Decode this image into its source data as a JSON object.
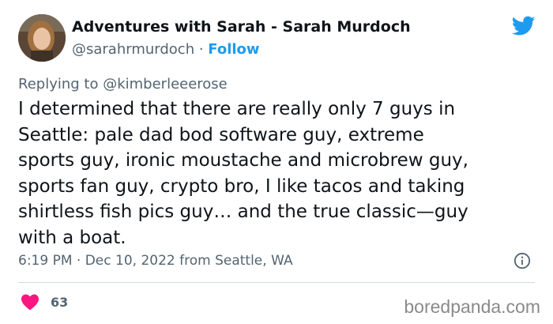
{
  "author": {
    "display_name": "Adventures with Sarah - Sarah Murdoch",
    "handle": "@sarahrmurdoch",
    "separator": " · ",
    "follow_label": "Follow"
  },
  "reply": {
    "prefix": "Replying to ",
    "mention": "@kimberleeerose"
  },
  "tweet": {
    "text": "I determined that there are really only 7 guys in\nSeattle: pale dad bod software guy, extreme\nsports guy, ironic moustache and microbrew guy,\nsports fan guy, crypto bro, I like tacos and taking\nshirtless fish pics guy… and the true classic—guy\nwith a boat.",
    "timestamp": "6:19 PM · Dec 10, 2022 from Seattle, WA"
  },
  "engagement": {
    "like_count": "63"
  },
  "watermark": "boredpanda.com",
  "icons": {
    "brand": "twitter-bird-icon",
    "info": "info-icon",
    "like": "heart-icon"
  },
  "colors": {
    "twitter_blue": "#1d9bf0",
    "heart": "#f91880",
    "secondary_text": "#536471"
  }
}
